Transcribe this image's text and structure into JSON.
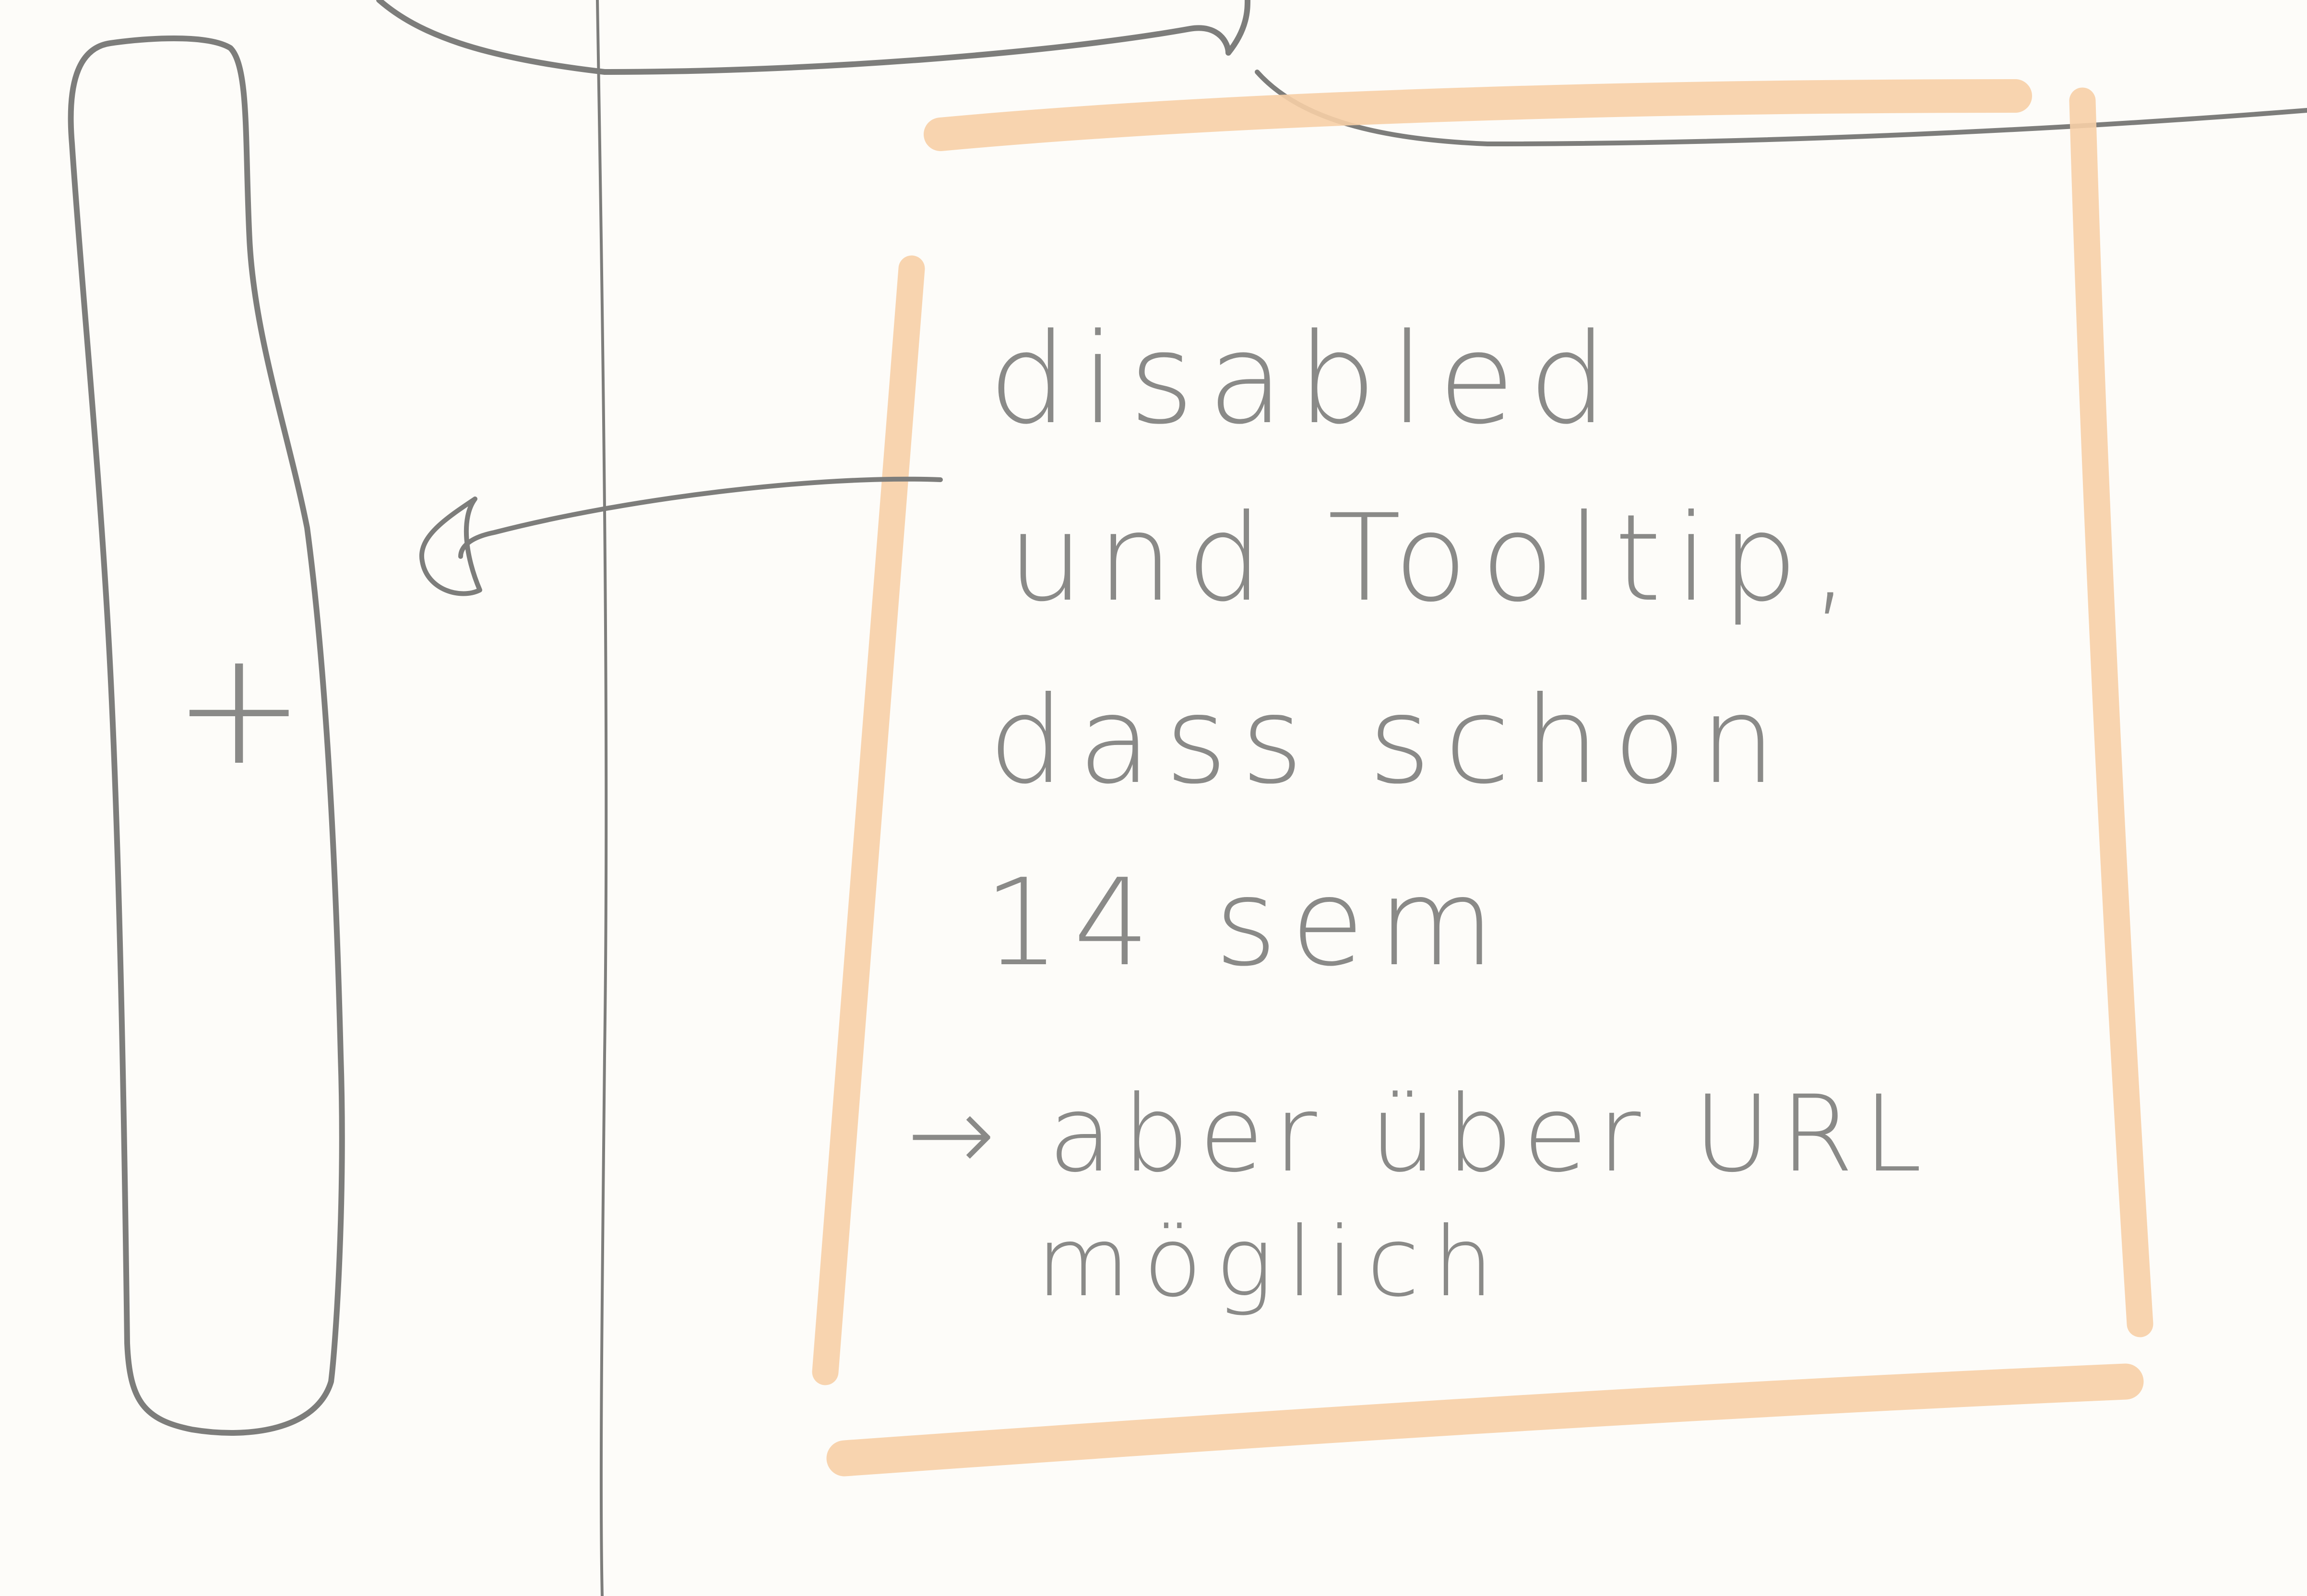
{
  "sketch": {
    "add_button": {
      "symbol": "+"
    },
    "note": {
      "lines": [
        "disabled",
        "und Tooltip,",
        "dass schon",
        "14 sem",
        "→ aber über URL",
        "möglich"
      ]
    },
    "colors": {
      "pencil": "#7d7d7b",
      "highlight": "#f7cfa6",
      "paper": "#fdfcf9"
    }
  }
}
